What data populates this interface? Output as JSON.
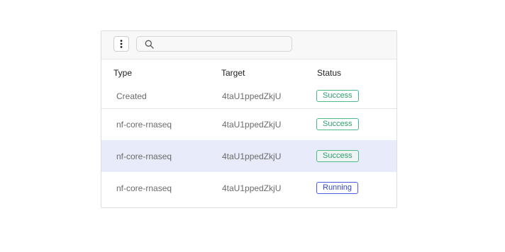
{
  "toolbar": {
    "menu_icon": "vertical-ellipsis-icon",
    "search_icon": "search-icon",
    "search_placeholder": "",
    "search_value": ""
  },
  "table": {
    "columns": [
      "Type",
      "Target",
      "Status"
    ],
    "rows": [
      {
        "type": "Created",
        "target": "4taU1ppedZkjU",
        "status": "Success"
      },
      {
        "type": "nf-core-rnaseq",
        "target": "4taU1ppedZkjU",
        "status": "Success"
      },
      {
        "type": "nf-core-rnaseq",
        "target": "4taU1ppedZkjU",
        "status": "Success",
        "selected": true
      },
      {
        "type": "nf-core-rnaseq",
        "target": "4taU1ppedZkjU",
        "status": "Running"
      }
    ]
  },
  "colors": {
    "success": "#2f9e6e",
    "running": "#3646c9",
    "selected_row": "#e8ebf9"
  }
}
